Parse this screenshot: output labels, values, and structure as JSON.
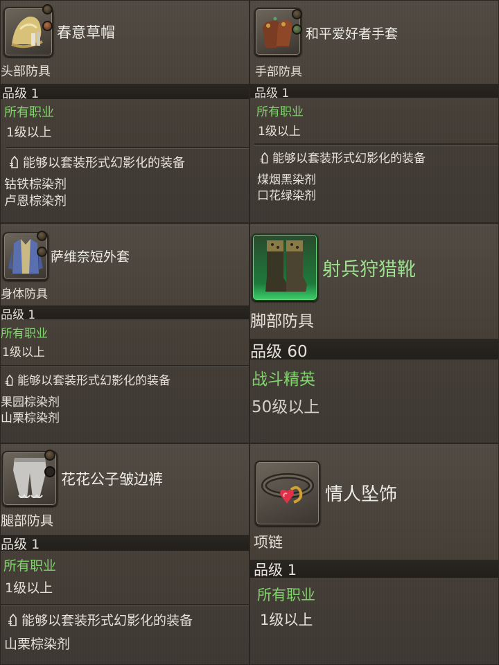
{
  "labels": {
    "item_level_prefix": "品级",
    "glamour_header": "能够以套装形式幻影化的装备"
  },
  "items": {
    "hat": {
      "name": "春意草帽",
      "slot": "头部防具",
      "item_level": "1",
      "classes": "所有职业",
      "level_req": "1级以上",
      "dyes": [
        "钴铁棕染剂",
        "卢恩棕染剂"
      ]
    },
    "gloves": {
      "name": "和平爱好者手套",
      "slot": "手部防具",
      "item_level": "1",
      "classes": "所有职业",
      "level_req": "1级以上",
      "dyes": [
        "煤烟黑染剂",
        "口花绿染剂"
      ]
    },
    "coat": {
      "name": "萨维奈短外套",
      "slot": "身体防具",
      "item_level": "1",
      "classes": "所有职业",
      "level_req": "1级以上",
      "dyes": [
        "果园棕染剂",
        "山栗棕染剂"
      ]
    },
    "boots": {
      "name": "射兵狩猎靴",
      "slot": "脚部防具",
      "item_level": "60",
      "classes": "战斗精英",
      "level_req": "50级以上"
    },
    "breeches": {
      "name": "花花公子皱边裤",
      "slot": "腿部防具",
      "item_level": "1",
      "classes": "所有职业",
      "level_req": "1级以上",
      "dyes": [
        "山栗棕染剂"
      ]
    },
    "necklace": {
      "name": "情人坠饰",
      "slot": "项链",
      "item_level": "1",
      "classes": "所有职业",
      "level_req": "1级以上"
    }
  },
  "colors": {
    "hq_name": "#9ee08f",
    "class_text": "#7fd46a",
    "panel_bg": "#4a443d"
  },
  "icons": {
    "hat": "straw-hat-icon",
    "gloves": "gloves-icon",
    "coat": "short-coat-icon",
    "boots": "hunting-boots-icon",
    "breeches": "ruffled-breeches-icon",
    "necklace": "heart-pendant-icon",
    "glamour": "glamour-set-icon"
  }
}
